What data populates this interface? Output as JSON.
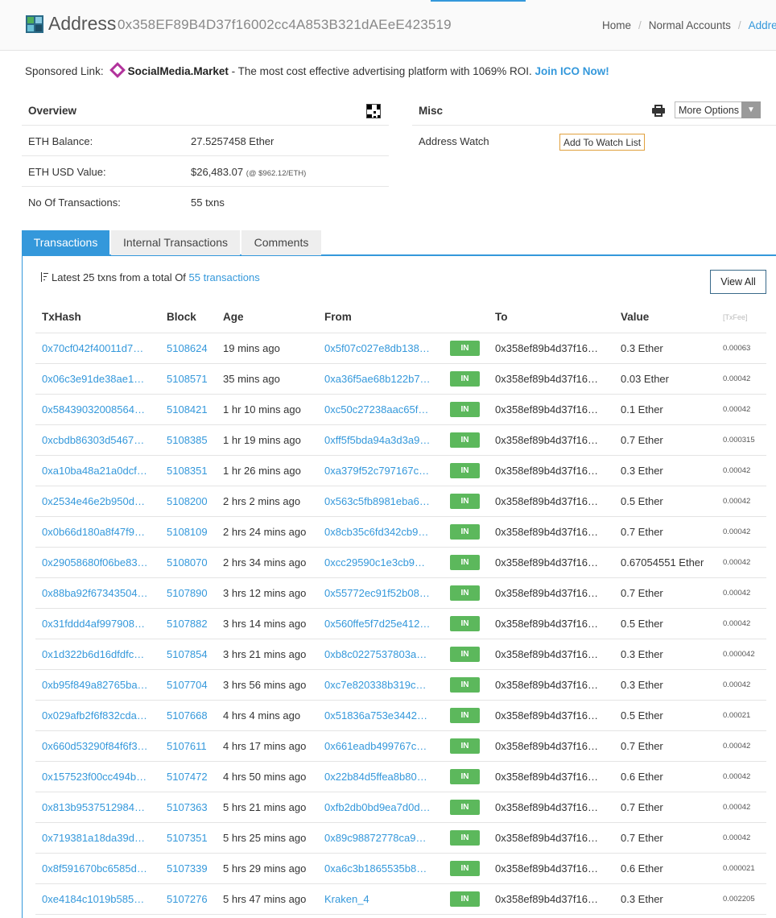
{
  "header": {
    "title": "Address",
    "hash": "0x358EF89B4D37f16002cc4A853B321dAEeE423519",
    "breadcrumb": [
      "Home",
      "Normal Accounts",
      "Address"
    ]
  },
  "sponsored": {
    "prefix": "Sponsored Link:",
    "brand": "SocialMedia.Market",
    "text": " - The most cost effective advertising platform with 1069% ROI. ",
    "cta": "Join ICO Now!"
  },
  "overview": {
    "title": "Overview",
    "rows": [
      {
        "label": "ETH Balance:",
        "value": "27.5257458 Ether",
        "note": ""
      },
      {
        "label": "ETH USD Value:",
        "value": "$26,483.07",
        "note": "(@ $962.12/ETH)"
      },
      {
        "label": "No Of Transactions:",
        "value": "55 txns",
        "note": ""
      }
    ]
  },
  "misc": {
    "title": "Misc",
    "more_options": "More Options",
    "address_watch_label": "Address Watch",
    "watch_button": "Add To Watch List"
  },
  "tabs": [
    "Transactions",
    "Internal Transactions",
    "Comments"
  ],
  "latest": {
    "text": "Latest 25 txns from a total Of ",
    "link": "55 transactions",
    "view_all": "View All"
  },
  "table": {
    "columns": [
      "TxHash",
      "Block",
      "Age",
      "From",
      "",
      "To",
      "Value",
      "[TxFee]"
    ],
    "rows": [
      {
        "hash": "0x70cf042f40011d7…",
        "block": "5108624",
        "age": "19 mins ago",
        "from": "0x5f07c027e8db138…",
        "dir": "IN",
        "to": "0x358ef89b4d37f16…",
        "value": "0.3 Ether",
        "fee": "0.00063"
      },
      {
        "hash": "0x06c3e91de38ae1…",
        "block": "5108571",
        "age": "35 mins ago",
        "from": "0xa36f5ae68b122b7…",
        "dir": "IN",
        "to": "0x358ef89b4d37f16…",
        "value": "0.03 Ether",
        "fee": "0.00042"
      },
      {
        "hash": "0x58439032008564…",
        "block": "5108421",
        "age": "1 hr 10 mins ago",
        "from": "0xc50c27238aac65f…",
        "dir": "IN",
        "to": "0x358ef89b4d37f16…",
        "value": "0.1 Ether",
        "fee": "0.00042"
      },
      {
        "hash": "0xcbdb86303d5467…",
        "block": "5108385",
        "age": "1 hr 19 mins ago",
        "from": "0xff5f5bda94a3d3a9…",
        "dir": "IN",
        "to": "0x358ef89b4d37f16…",
        "value": "0.7 Ether",
        "fee": "0.000315"
      },
      {
        "hash": "0xa10ba48a21a0dcf…",
        "block": "5108351",
        "age": "1 hr 26 mins ago",
        "from": "0xa379f52c797167c…",
        "dir": "IN",
        "to": "0x358ef89b4d37f16…",
        "value": "0.3 Ether",
        "fee": "0.00042"
      },
      {
        "hash": "0x2534e46e2b950d…",
        "block": "5108200",
        "age": "2 hrs 2 mins ago",
        "from": "0x563c5fb8981eba6…",
        "dir": "IN",
        "to": "0x358ef89b4d37f16…",
        "value": "0.5 Ether",
        "fee": "0.00042"
      },
      {
        "hash": "0x0b66d180a8f47f9…",
        "block": "5108109",
        "age": "2 hrs 24 mins ago",
        "from": "0x8cb35c6fd342cb9…",
        "dir": "IN",
        "to": "0x358ef89b4d37f16…",
        "value": "0.7 Ether",
        "fee": "0.00042"
      },
      {
        "hash": "0x29058680f06be83…",
        "block": "5108070",
        "age": "2 hrs 34 mins ago",
        "from": "0xcc29590c1e3cb9…",
        "dir": "IN",
        "to": "0x358ef89b4d37f16…",
        "value": "0.67054551 Ether",
        "fee": "0.00042"
      },
      {
        "hash": "0x88ba92f67343504…",
        "block": "5107890",
        "age": "3 hrs 12 mins ago",
        "from": "0x55772ec91f52b08…",
        "dir": "IN",
        "to": "0x358ef89b4d37f16…",
        "value": "0.7 Ether",
        "fee": "0.00042"
      },
      {
        "hash": "0x31fddd4af997908…",
        "block": "5107882",
        "age": "3 hrs 14 mins ago",
        "from": "0x560ffe5f7d25e412…",
        "dir": "IN",
        "to": "0x358ef89b4d37f16…",
        "value": "0.5 Ether",
        "fee": "0.00042"
      },
      {
        "hash": "0x1d322b6d16dfdfc…",
        "block": "5107854",
        "age": "3 hrs 21 mins ago",
        "from": "0xb8c0227537803a…",
        "dir": "IN",
        "to": "0x358ef89b4d37f16…",
        "value": "0.3 Ether",
        "fee": "0.000042"
      },
      {
        "hash": "0xb95f849a82765ba…",
        "block": "5107704",
        "age": "3 hrs 56 mins ago",
        "from": "0xc7e820338b319c…",
        "dir": "IN",
        "to": "0x358ef89b4d37f16…",
        "value": "0.3 Ether",
        "fee": "0.00042"
      },
      {
        "hash": "0x029afb2f6f832cda…",
        "block": "5107668",
        "age": "4 hrs 4 mins ago",
        "from": "0x51836a753e3442…",
        "dir": "IN",
        "to": "0x358ef89b4d37f16…",
        "value": "0.5 Ether",
        "fee": "0.00021"
      },
      {
        "hash": "0x660d53290f84f6f3…",
        "block": "5107611",
        "age": "4 hrs 17 mins ago",
        "from": "0x661eadb499767c…",
        "dir": "IN",
        "to": "0x358ef89b4d37f16…",
        "value": "0.7 Ether",
        "fee": "0.00042"
      },
      {
        "hash": "0x157523f00cc494b…",
        "block": "5107472",
        "age": "4 hrs 50 mins ago",
        "from": "0x22b84d5ffea8b80…",
        "dir": "IN",
        "to": "0x358ef89b4d37f16…",
        "value": "0.6 Ether",
        "fee": "0.00042"
      },
      {
        "hash": "0x813b9537512984…",
        "block": "5107363",
        "age": "5 hrs 21 mins ago",
        "from": "0xfb2db0bd9ea7d0d…",
        "dir": "IN",
        "to": "0x358ef89b4d37f16…",
        "value": "0.7 Ether",
        "fee": "0.00042"
      },
      {
        "hash": "0x719381a18da39d…",
        "block": "5107351",
        "age": "5 hrs 25 mins ago",
        "from": "0x89c98872778ca9…",
        "dir": "IN",
        "to": "0x358ef89b4d37f16…",
        "value": "0.7 Ether",
        "fee": "0.00042"
      },
      {
        "hash": "0x8f591670bc6585d…",
        "block": "5107339",
        "age": "5 hrs 29 mins ago",
        "from": "0xa6c3b1865535b8…",
        "dir": "IN",
        "to": "0x358ef89b4d37f16…",
        "value": "0.6 Ether",
        "fee": "0.000021"
      },
      {
        "hash": "0xe4184c1019b585…",
        "block": "5107276",
        "age": "5 hrs 47 mins ago",
        "from": "Kraken_4",
        "dir": "IN",
        "to": "0x358ef89b4d37f16…",
        "value": "0.3 Ether",
        "fee": "0.002205"
      }
    ]
  }
}
